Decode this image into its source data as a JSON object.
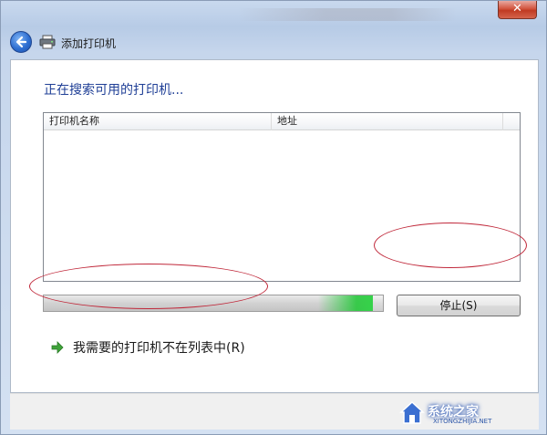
{
  "window": {
    "title": "添加打印机",
    "close_label": "✕"
  },
  "page": {
    "heading": "正在搜索可用的打印机..."
  },
  "printer_list": {
    "columns": [
      "打印机名称",
      "地址"
    ],
    "rows": []
  },
  "progress": {
    "fraction": 0.97
  },
  "buttons": {
    "stop_label": "停止(S)"
  },
  "link": {
    "label": "我需要的打印机不在列表中(R)"
  },
  "watermark": {
    "text": "系统之家",
    "sub": "XITONGZHIJIA.NET"
  },
  "colors": {
    "heading": "#1f3f96",
    "annotation": "#c0283a",
    "progress_glow": "#36d24a"
  }
}
